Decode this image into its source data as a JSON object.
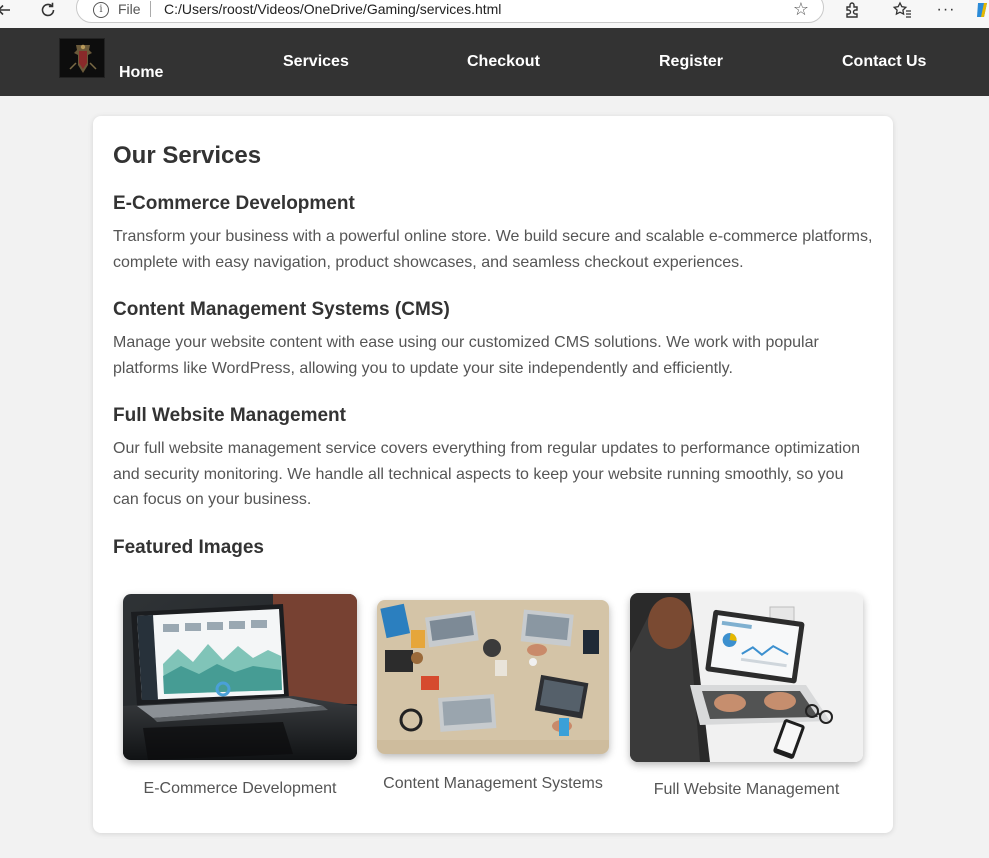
{
  "browser": {
    "file_label": "File",
    "url": "C:/Users/roost/Videos/OneDrive/Gaming/services.html"
  },
  "nav": {
    "items": [
      "Home",
      "Services",
      "Checkout",
      "Register",
      "Contact Us"
    ]
  },
  "main": {
    "title": "Our Services",
    "sections": [
      {
        "heading": "E-Commerce Development",
        "text": "Transform your business with a powerful online store. We build secure and scalable e-commerce platforms, complete with easy navigation, product showcases, and seamless checkout experiences."
      },
      {
        "heading": "Content Management Systems (CMS)",
        "text": "Manage your website content with ease using our customized CMS solutions. We work with popular platforms like WordPress, allowing you to update your site independently and efficiently."
      },
      {
        "heading": "Full Website Management",
        "text": "Our full website management service covers everything from regular updates to performance optimization and security monitoring. We handle all technical aspects to keep your website running smoothly, so you can focus on your business."
      }
    ],
    "featured_heading": "Featured Images",
    "featured": [
      {
        "caption": "E-Commerce Development",
        "icon": "laptop-dashboard-image"
      },
      {
        "caption": "Content Management Systems",
        "icon": "team-desk-image"
      },
      {
        "caption": "Full Website Management",
        "icon": "typing-laptop-image"
      }
    ]
  }
}
